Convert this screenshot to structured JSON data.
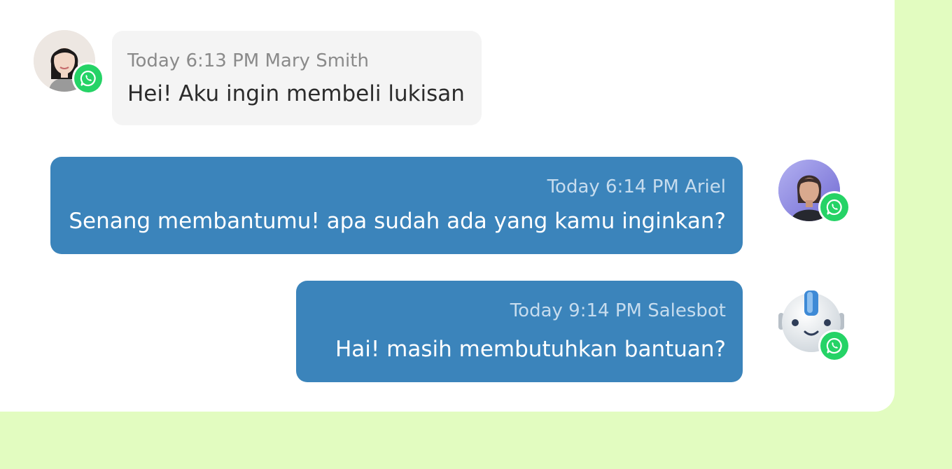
{
  "messages": [
    {
      "direction": "incoming",
      "meta": "Today 6:13 PM Mary Smith",
      "text": "Hei! Aku ingin membeli lukisan",
      "avatar": "customer-avatar",
      "channel_icon": "whatsapp-icon"
    },
    {
      "direction": "outgoing",
      "meta": "Today 6:14 PM Ariel",
      "text": "Senang membantumu! apa sudah ada yang kamu inginkan?",
      "avatar": "agent-avatar",
      "channel_icon": "whatsapp-icon"
    },
    {
      "direction": "outgoing",
      "meta": "Today 9:14 PM Salesbot",
      "text": "Hai! masih membutuhkan bantuan?",
      "avatar": "bot-avatar",
      "channel_icon": "whatsapp-icon"
    }
  ],
  "colors": {
    "page_background": "#e2fcc0",
    "panel": "#ffffff",
    "incoming_bubble": "#f4f4f4",
    "outgoing_bubble": "#3b84bb",
    "whatsapp": "#25d366"
  }
}
